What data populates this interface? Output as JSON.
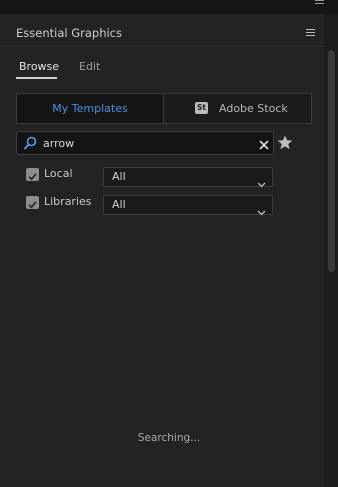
{
  "panel": {
    "title": "Essential Graphics"
  },
  "tabs": [
    {
      "label": "Browse",
      "active": true
    },
    {
      "label": "Edit",
      "active": false
    }
  ],
  "source_toggle": {
    "my_templates": "My Templates",
    "adobe_stock_badge": "St",
    "adobe_stock": "Adobe Stock"
  },
  "search": {
    "value": "arrow",
    "icons": [
      "search-icon",
      "clear-icon",
      "star-icon"
    ]
  },
  "filters": [
    {
      "label": "Local",
      "checked": true,
      "dropdown_value": "All"
    },
    {
      "label": "Libraries",
      "checked": true,
      "dropdown_value": "All"
    }
  ],
  "status": "Searching...",
  "colors": {
    "accent": "#4d8fe0",
    "panel_bg": "#232323"
  }
}
